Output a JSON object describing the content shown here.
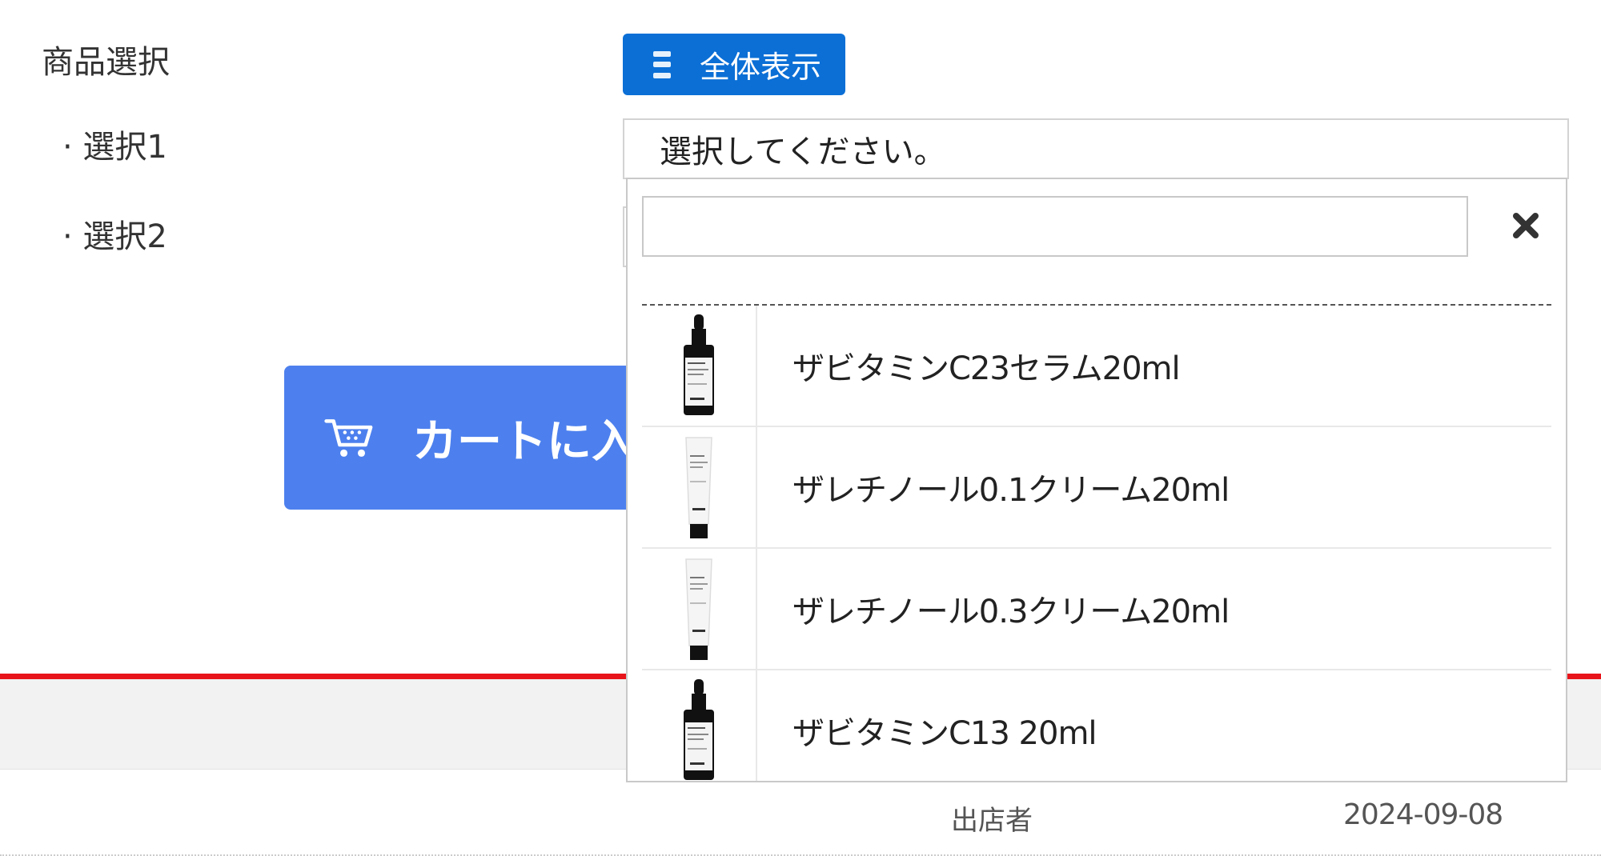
{
  "form": {
    "title": "商品選択",
    "select1_label": "· 選択1",
    "select2_label": "· 選択2",
    "select1_value": "選択してください。"
  },
  "full_view_button": {
    "label": "全体表示",
    "icon": "list-icon"
  },
  "cart_button": {
    "label": "カートに入",
    "icon": "cart-icon"
  },
  "dropdown": {
    "search_value": "",
    "close_icon": "close-icon",
    "items": [
      {
        "label": "ザビタミンC23セラム20ml",
        "thumb": "dropper-bottle"
      },
      {
        "label": "ザレチノール0.1クリーム20ml",
        "thumb": "cream-tube"
      },
      {
        "label": "ザレチノール0.3クリーム20ml",
        "thumb": "cream-tube"
      },
      {
        "label": "ザビタミンC13 20ml",
        "thumb": "dropper-bottle"
      }
    ]
  },
  "footer": {
    "seller": "出店者",
    "date": "2024-09-08"
  },
  "colors": {
    "primary_blue": "#0b6fd6",
    "cart_blue": "#4d80ee",
    "accent_red": "#e8141b"
  }
}
